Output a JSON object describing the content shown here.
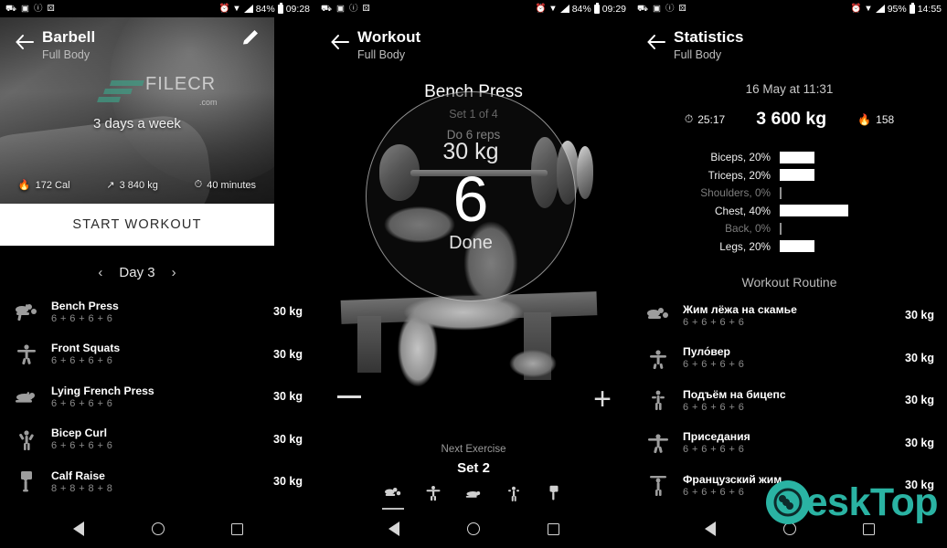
{
  "panels": [
    {
      "status_bar": {
        "time": "09:28",
        "battery": "84%"
      },
      "app_bar": {
        "title": "Barbell",
        "subtitle": "Full Body",
        "back_icon": "back-arrow-icon",
        "edit_icon": "pencil-edit-icon"
      },
      "hero": {
        "frequency": "3 days a week",
        "stats": [
          {
            "icon": "flame-icon",
            "value": "172 Cal"
          },
          {
            "icon": "weight-arrows-icon",
            "value": "3 840 kg"
          },
          {
            "icon": "stopwatch-icon",
            "value": "40 minutes"
          }
        ]
      },
      "start_button": "START WORKOUT",
      "day_nav": {
        "prev": "‹",
        "label": "Day 3",
        "next": "›"
      },
      "exercises": [
        {
          "name": "Bench Press",
          "reps": "6 + 6 + 6 + 6",
          "weight": "30 kg"
        },
        {
          "name": "Front Squats",
          "reps": "6 + 6 + 6 + 6",
          "weight": "30 kg"
        },
        {
          "name": "Lying French Press",
          "reps": "6 + 6 + 6 + 6",
          "weight": "30 kg"
        },
        {
          "name": "Bicep Curl",
          "reps": "6 + 6 + 6 + 6",
          "weight": "30 kg"
        },
        {
          "name": "Calf Raise",
          "reps": "8 + 8 + 8 + 8",
          "weight": "30 kg"
        }
      ],
      "watermark": {
        "text": "FILECR",
        "suffix": ".com"
      }
    },
    {
      "status_bar": {
        "time": "09:29",
        "battery": "84%"
      },
      "app_bar": {
        "title": "Workout",
        "subtitle": "Full Body",
        "back_icon": "back-arrow-icon"
      },
      "exercise": {
        "name": "Bench Press",
        "set_progress": "Set 1 of 4",
        "instruction": "Do 6 reps"
      },
      "dial": {
        "weight": "30 kg",
        "reps": "6",
        "action": "Done"
      },
      "controls": {
        "decrease": "—",
        "increase": "+"
      },
      "next": {
        "label": "Next Exercise",
        "value": "Set 2"
      },
      "filmstrip": [
        {
          "name": "bench-press-thumb",
          "active": true
        },
        {
          "name": "front-squats-thumb",
          "active": false
        },
        {
          "name": "lying-french-press-thumb",
          "active": false
        },
        {
          "name": "bicep-curl-thumb",
          "active": false
        },
        {
          "name": "calf-raise-thumb",
          "active": false
        }
      ]
    },
    {
      "status_bar": {
        "time": "14:55",
        "battery": "95%"
      },
      "app_bar": {
        "title": "Statistics",
        "subtitle": "Full Body",
        "back_icon": "back-arrow-icon"
      },
      "session_date": "16 May at 11:31",
      "summary": [
        {
          "icon": "stopwatch-icon",
          "value": "25:17"
        },
        {
          "icon": "none",
          "value": "3 600 kg"
        },
        {
          "icon": "flame-icon",
          "value": "158"
        }
      ],
      "routine_title": "Workout Routine",
      "exercises": [
        {
          "name": "Жим лёжа на скамье",
          "reps": "6 + 6 + 6 + 6",
          "weight": "30 kg"
        },
        {
          "name": "Пуло́вер",
          "reps": "6 + 6 + 6 + 6",
          "weight": "30 kg"
        },
        {
          "name": "Подъём на бицепс",
          "reps": "6 + 6 + 6 + 6",
          "weight": "30 kg"
        },
        {
          "name": "Приседания",
          "reps": "6 + 6 + 6 + 6",
          "weight": "30 kg"
        },
        {
          "name": "Французский жим",
          "reps": "6 + 6 + 6 + 6",
          "weight": "30 kg"
        }
      ]
    }
  ],
  "chart_data": {
    "type": "bar",
    "title": "",
    "orientation": "horizontal",
    "categories": [
      "Biceps",
      "Triceps",
      "Shoulders",
      "Chest",
      "Back",
      "Legs"
    ],
    "values": [
      20,
      20,
      0,
      40,
      0,
      20
    ],
    "labels": [
      "Biceps, 20%",
      "Triceps, 20%",
      "Shoulders,  0%",
      "Chest, 40%",
      "Back,  0%",
      "Legs, 20%"
    ],
    "unit": "%",
    "xlim": [
      0,
      40
    ],
    "bar_color": "#ffffff",
    "grid": false,
    "legend": false
  },
  "nav_bar": {
    "back": "back-triangle-icon",
    "home": "home-circle-icon",
    "recents": "recents-square-icon"
  },
  "watermark_desktop": {
    "text": "eskTop",
    "initial": "D",
    "color": "#2ab3a3"
  }
}
